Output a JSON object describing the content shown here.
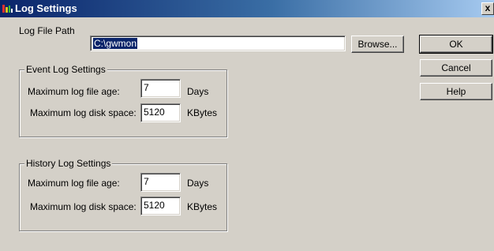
{
  "window": {
    "title": "Log Settings",
    "close_glyph": "x"
  },
  "log_file_path": {
    "label": "Log File Path",
    "value": "C:\\gwmon",
    "browse_label": "Browse..."
  },
  "buttons": {
    "ok": "OK",
    "cancel": "Cancel",
    "help": "Help"
  },
  "event_log": {
    "title": "Event Log Settings",
    "age_label": "Maximum log file age:",
    "age_value": "7",
    "age_unit": "Days",
    "space_label": "Maximum log disk space:",
    "space_value": "5120",
    "space_unit": "KBytes"
  },
  "history_log": {
    "title": "History Log Settings",
    "age_label": "Maximum log file age:",
    "age_value": "7",
    "age_unit": "Days",
    "space_label": "Maximum log disk space:",
    "space_value": "5120",
    "space_unit": "KBytes"
  },
  "colors": {
    "titlebar_start": "#0a246a",
    "titlebar_end": "#a6caf0",
    "dialog_bg": "#d4d0c8",
    "selection": "#0a246a"
  },
  "icons": {
    "title_icon": "log-settings-icon"
  }
}
